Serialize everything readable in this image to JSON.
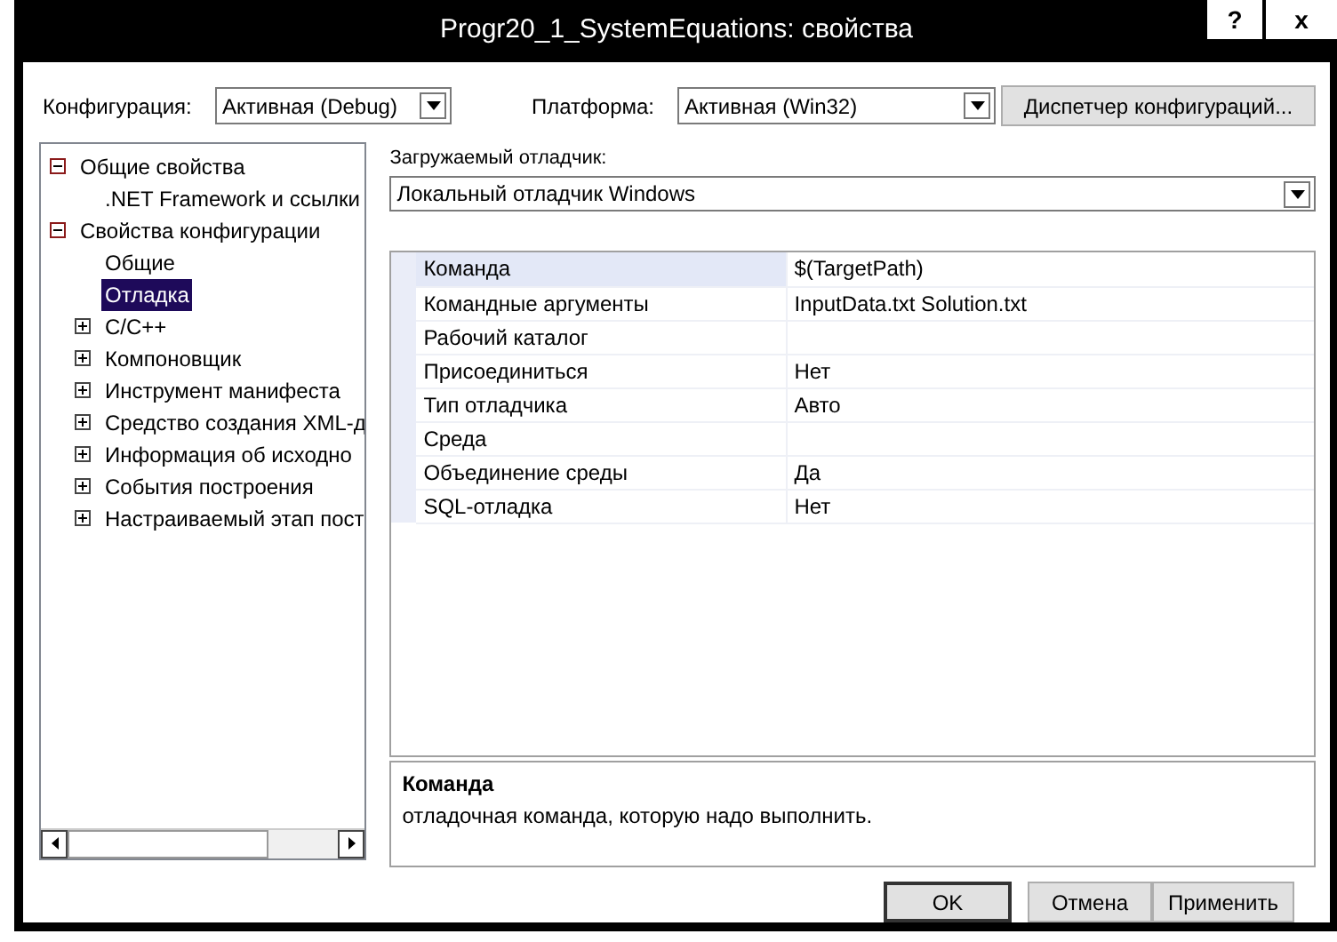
{
  "window": {
    "title": "Progr20_1_SystemEquations: свойства",
    "help_button": "?",
    "close_button": "x"
  },
  "configuration": {
    "label": "Конфигурация:",
    "value": "Активная (Debug)"
  },
  "platform": {
    "label": "Платформа:",
    "value": "Активная (Win32)"
  },
  "config_manager_button": "Диспетчер конфигураций...",
  "tree": [
    {
      "label": "Общие свойства",
      "expanded": true,
      "selected": false,
      "children": [
        {
          "label": ".NET Framework и ссылки",
          "selected": false
        }
      ]
    },
    {
      "label": "Свойства конфигурации",
      "expanded": true,
      "selected": false,
      "children": [
        {
          "label": "Общие",
          "selected": false
        },
        {
          "label": "Отладка",
          "selected": true
        },
        {
          "label": "C/C++",
          "expanded": false,
          "selected": false
        },
        {
          "label": "Компоновщик",
          "expanded": false,
          "selected": false
        },
        {
          "label": "Инструмент манифеста",
          "expanded": false,
          "selected": false
        },
        {
          "label": "Средство создания XML-д",
          "expanded": false,
          "selected": false
        },
        {
          "label": "Информация об исходно",
          "expanded": false,
          "selected": false
        },
        {
          "label": "События построения",
          "expanded": false,
          "selected": false
        },
        {
          "label": "Настраиваемый этап пост",
          "expanded": false,
          "selected": false
        }
      ]
    }
  ],
  "debugger": {
    "label": "Загружаемый отладчик:",
    "value": "Локальный отладчик Windows"
  },
  "properties": [
    {
      "name": "Команда",
      "value": "$(TargetPath)",
      "selected": true
    },
    {
      "name": "Командные аргументы",
      "value": "InputData.txt Solution.txt",
      "selected": false
    },
    {
      "name": "Рабочий каталог",
      "selected": false
    },
    {
      "name": "Присоединиться",
      "value": "Нет",
      "selected": false
    },
    {
      "name": "Тип отладчика",
      "value": "Авто",
      "selected": false
    },
    {
      "name": "Среда",
      "selected": false
    },
    {
      "name": "Объединение среды",
      "value": "Да",
      "selected": false
    },
    {
      "name": "SQL-отладка",
      "value": "Нет",
      "selected": false
    }
  ],
  "description": {
    "title": "Команда",
    "text": "отладочная команда, которую надо выполнить."
  },
  "buttons": [
    {
      "label": "OK",
      "default": true
    },
    {
      "label": "Отмена",
      "default": false
    },
    {
      "label": "Применить",
      "default": false
    }
  ]
}
